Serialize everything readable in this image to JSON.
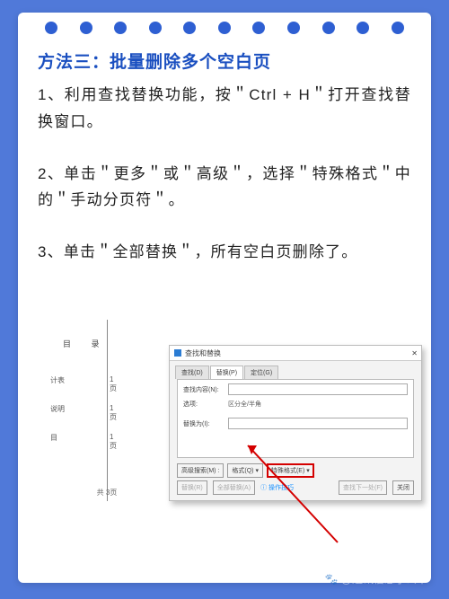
{
  "title": "方法三：批量删除多个空白页",
  "steps": [
    "1、利用查找替换功能，按＂Ctrl + H＂打开查找替换窗口。",
    "2、单击＂更多＂或＂高级＂，选择＂特殊格式＂中的＂手动分页符＂。",
    "3、单击＂全部替换＂，所有空白页删除了。"
  ],
  "doc": {
    "toc": "目 录",
    "rows": [
      {
        "a": "计表",
        "b": "1 页"
      },
      {
        "a": "说明",
        "b": "1 页"
      },
      {
        "a": "目",
        "b": "1 页"
      }
    ],
    "footer": "共 3页"
  },
  "dialog": {
    "title": "查找和替换",
    "tabs": [
      "查找(D)",
      "替换(P)",
      "定位(G)"
    ],
    "find_label": "查找内容(N):",
    "option_label": "选项:",
    "option_value": "区分全/半角",
    "replace_label": "替换为(I):",
    "buttons": {
      "more": "高级搜索(M) :",
      "format": "格式(Q) ▾",
      "special": "特殊格式(E) ▾",
      "replace": "替换(R)",
      "replace_all": "全部替换(A)",
      "find_next": "查找下一处(F)",
      "close": "关闭"
    },
    "tip": "ⓘ 操作技巧"
  },
  "watermark": "🐾 @通讯信息小公举"
}
